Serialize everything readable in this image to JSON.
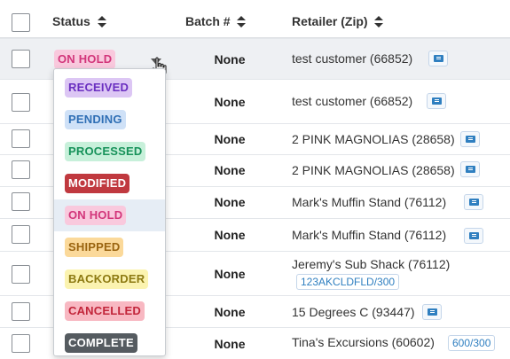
{
  "header": {
    "status": "Status",
    "batch": "Batch #",
    "retailer": "Retailer (Zip)"
  },
  "rows": [
    {
      "batch": "None",
      "retailer": "test customer (66852)",
      "status": "ON HOLD"
    },
    {
      "batch": "None",
      "retailer": "test customer (66852)"
    },
    {
      "batch": "None",
      "retailer": "2 PINK MAGNOLIAS (28658)"
    },
    {
      "batch": "None",
      "retailer": "2 PINK MAGNOLIAS (28658)"
    },
    {
      "batch": "None",
      "retailer": "Mark's Muffin Stand (76112)"
    },
    {
      "batch": "None",
      "retailer": "Mark's Muffin Stand (76112)"
    },
    {
      "batch": "None",
      "retailer": "Jeremy's Sub Shack (76112)",
      "tag": "123AKCLDFLD/300"
    },
    {
      "batch": "None",
      "retailer": "15 Degrees C (93447)"
    },
    {
      "batch": "None",
      "retailer": "Tina's Excursions (60602)",
      "tag": "600/300"
    }
  ],
  "status_menu": [
    "RECEIVED",
    "PENDING",
    "PROCESSED",
    "MODIFIED",
    "ON HOLD",
    "SHIPPED",
    "BACKORDER",
    "CANCELLED",
    "COMPLETE"
  ],
  "icons": {
    "sort": "sort-icon",
    "dropdown": "caret-down-icon",
    "cursor": "hand-pointer-icon",
    "retailer_card": "id-card-icon"
  },
  "colors": {
    "on_hold_bg": "#f9c9dd",
    "received_bg": "#dcc6f4",
    "pending_bg": "#cfe1f7",
    "processed_bg": "#c7f0da",
    "modified_bg": "#c0393f",
    "shipped_bg": "#fbd99a",
    "backorder_bg": "#fbf3b0",
    "cancelled_bg": "#f8b8c2",
    "complete_bg": "#555b60",
    "link_blue": "#2f7fc0"
  }
}
